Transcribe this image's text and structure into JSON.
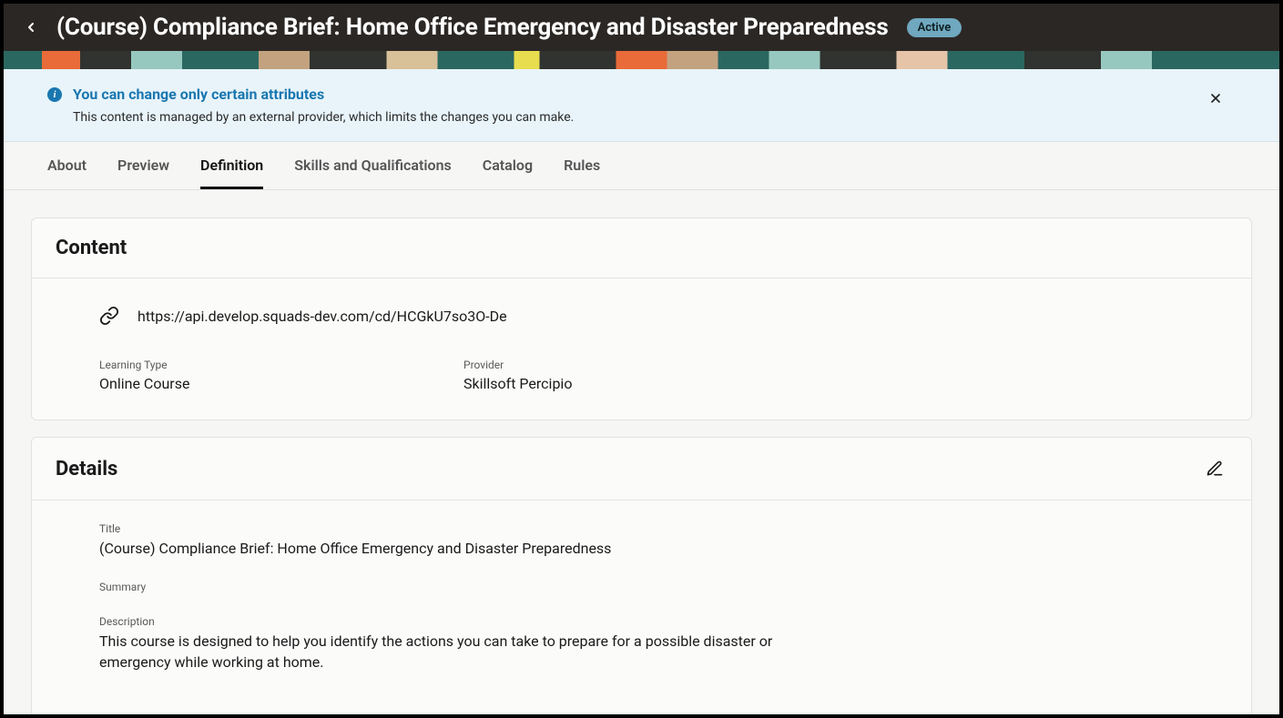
{
  "header": {
    "title": "(Course) Compliance Brief: Home Office Emergency and Disaster Preparedness",
    "status": "Active"
  },
  "notice": {
    "title": "You can change only certain attributes",
    "body": "This content is managed by an external provider, which limits the changes you can make."
  },
  "tabs": [
    "About",
    "Preview",
    "Definition",
    "Skills and Qualifications",
    "Catalog",
    "Rules"
  ],
  "active_tab": "Definition",
  "content_card": {
    "title": "Content",
    "url": "https://api.develop.squads-dev.com/cd/HCGkU7so3O-De",
    "fields": [
      {
        "label": "Learning Type",
        "value": "Online Course"
      },
      {
        "label": "Provider",
        "value": "Skillsoft Percipio"
      }
    ]
  },
  "details_card": {
    "title": "Details",
    "items": [
      {
        "label": "Title",
        "value": "(Course) Compliance Brief: Home Office Emergency and Disaster Preparedness"
      },
      {
        "label": "Summary",
        "value": ""
      },
      {
        "label": "Description",
        "value": "This course is designed to help you identify the actions you can take to prepare for a possible disaster or emergency while working at home."
      }
    ]
  }
}
